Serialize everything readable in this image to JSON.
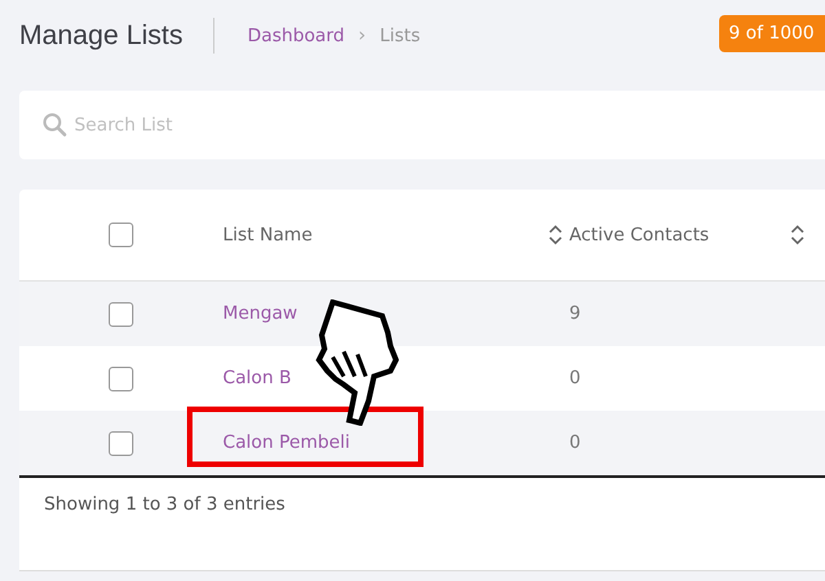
{
  "header": {
    "title": "Manage Lists",
    "breadcrumb": [
      {
        "label": "Dashboard",
        "kind": "link"
      },
      {
        "label": "›",
        "kind": "separator"
      },
      {
        "label": "Lists",
        "kind": "current"
      }
    ],
    "badge": "9 of 1000"
  },
  "search": {
    "placeholder": "Search List"
  },
  "table": {
    "select_all": {
      "checked": false
    },
    "columns": [
      {
        "label": "List Name",
        "sortable": true
      },
      {
        "label": "Active Contacts",
        "sortable": true
      }
    ],
    "rows": [
      {
        "checked": false,
        "name": "Mengaw",
        "active_contacts": "9",
        "highlighted": false
      },
      {
        "checked": false,
        "name": "Calon B",
        "active_contacts": "0",
        "highlighted": false
      },
      {
        "checked": false,
        "name": "Calon Pembeli",
        "active_contacts": "0",
        "highlighted": true
      }
    ],
    "footer": "Showing 1 to 3 of 3 entries"
  },
  "cursor": {
    "kind": "hand"
  }
}
